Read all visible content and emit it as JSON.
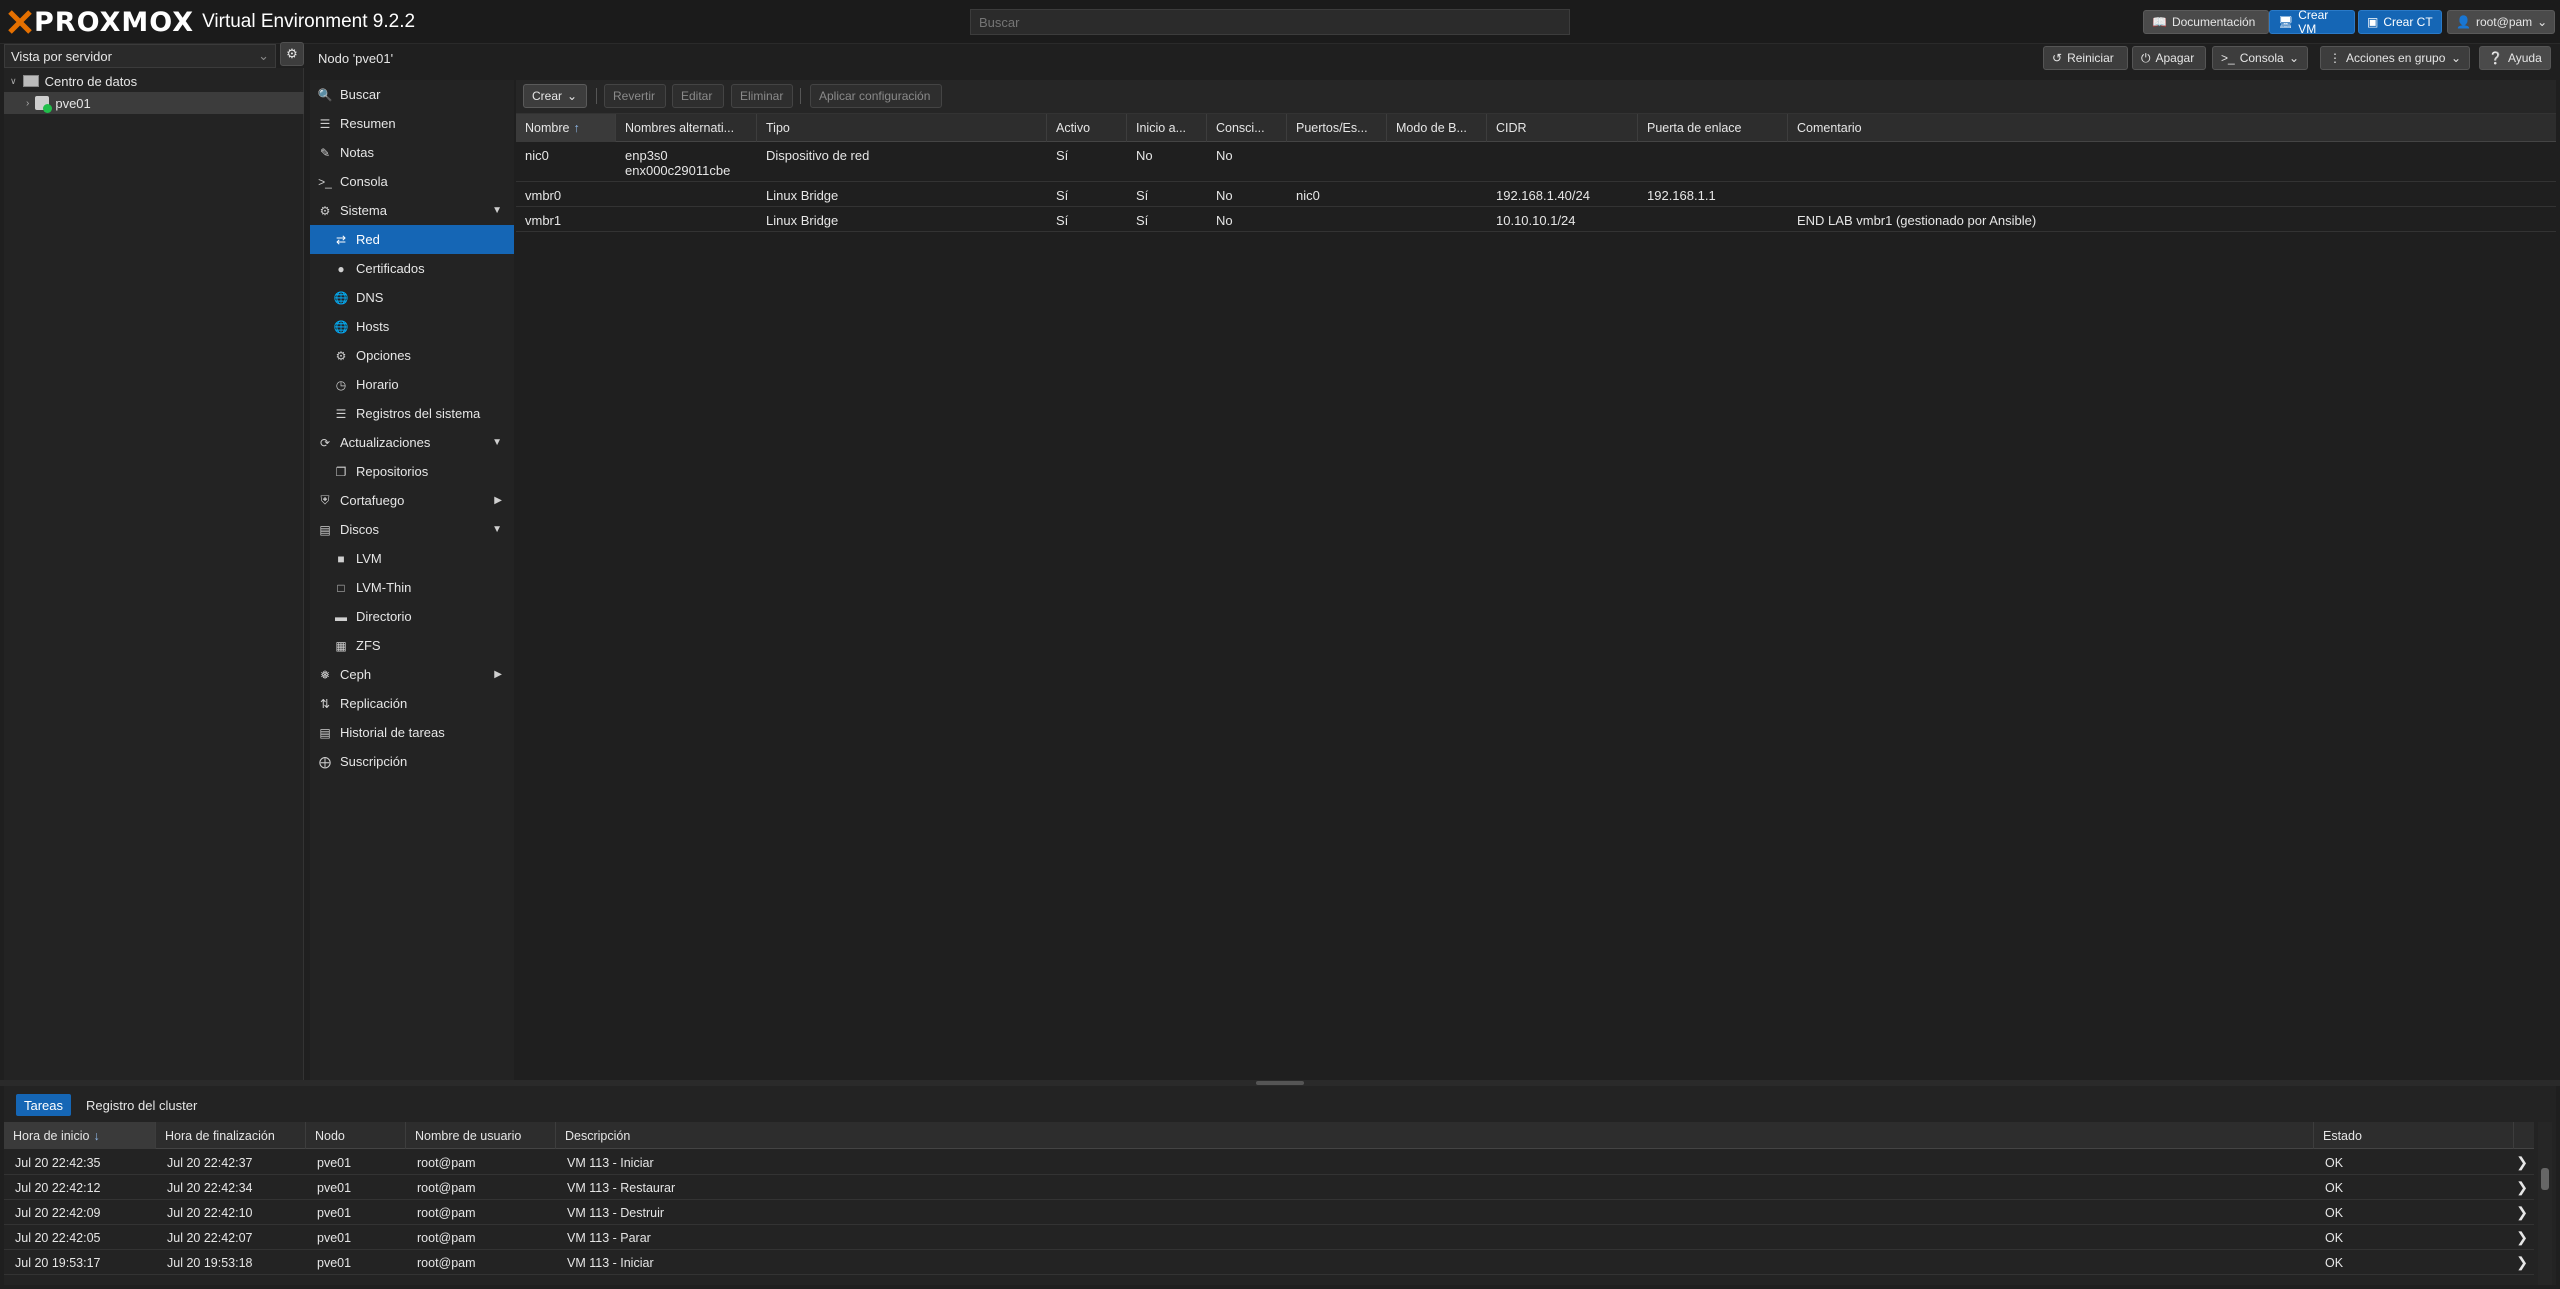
{
  "app": {
    "logo_text": "PROXMOX",
    "product": "Virtual Environment 9.2.2",
    "search_placeholder": "Buscar"
  },
  "topbar": {
    "docs": "Documentación",
    "create_vm": "Crear VM",
    "create_ct": "Crear CT",
    "user": "root@pam"
  },
  "resource_tree": {
    "view": "Vista por servidor",
    "datacenter": "Centro de datos",
    "node": "pve01"
  },
  "node_header": {
    "title": "Nodo 'pve01'",
    "reboot": "Reiniciar",
    "shutdown": "Apagar",
    "console": "Consola",
    "bulk": "Acciones en grupo",
    "help": "Ayuda"
  },
  "nav": [
    {
      "label": "Buscar",
      "icon": "search-icon"
    },
    {
      "label": "Resumen",
      "icon": "book-icon"
    },
    {
      "label": "Notas",
      "icon": "notes-icon"
    },
    {
      "label": "Consola",
      "icon": "terminal-icon"
    },
    {
      "label": "Sistema",
      "icon": "cogs-icon"
    },
    {
      "label": "Red",
      "icon": "exchange-icon"
    },
    {
      "label": "Certificados",
      "icon": "certificate-icon"
    },
    {
      "label": "DNS",
      "icon": "globe-icon"
    },
    {
      "label": "Hosts",
      "icon": "globe-icon"
    },
    {
      "label": "Opciones",
      "icon": "gear-icon"
    },
    {
      "label": "Horario",
      "icon": "clock-icon"
    },
    {
      "label": "Registros del sistema",
      "icon": "list-icon"
    },
    {
      "label": "Actualizaciones",
      "icon": "refresh-icon"
    },
    {
      "label": "Repositorios",
      "icon": "files-icon"
    },
    {
      "label": "Cortafuego",
      "icon": "shield-icon"
    },
    {
      "label": "Discos",
      "icon": "hdd-icon"
    },
    {
      "label": "LVM",
      "icon": "square-icon"
    },
    {
      "label": "LVM-Thin",
      "icon": "square-outline-icon"
    },
    {
      "label": "Directorio",
      "icon": "folder-icon"
    },
    {
      "label": "ZFS",
      "icon": "th-large-icon"
    },
    {
      "label": "Ceph",
      "icon": "ceph-icon"
    },
    {
      "label": "Replicación",
      "icon": "retweet-icon"
    },
    {
      "label": "Historial de tareas",
      "icon": "list-alt-icon"
    },
    {
      "label": "Suscripción",
      "icon": "support-icon"
    }
  ],
  "network_toolbar": {
    "create": "Crear",
    "revert": "Revertir",
    "edit": "Editar",
    "remove": "Eliminar",
    "apply": "Aplicar configuración"
  },
  "network_columns": [
    "Nombre",
    "Nombres alternati...",
    "Tipo",
    "Activo",
    "Inicio a...",
    "Consci...",
    "Puertos/Es...",
    "Modo de B...",
    "CIDR",
    "Puerta de enlace",
    "Comentario"
  ],
  "network_rows": [
    {
      "name": "nic0",
      "alt": "enp3s0\nenx000c29011cbe",
      "type": "Dispositivo de red",
      "active": "Sí",
      "autostart": "No",
      "vlan_aware": "No",
      "ports": "",
      "bond_mode": "",
      "cidr": "",
      "gateway": "",
      "comment": ""
    },
    {
      "name": "vmbr0",
      "alt": "",
      "type": "Linux Bridge",
      "active": "Sí",
      "autostart": "Sí",
      "vlan_aware": "No",
      "ports": "nic0",
      "bond_mode": "",
      "cidr": "192.168.1.40/24",
      "gateway": "192.168.1.1",
      "comment": ""
    },
    {
      "name": "vmbr1",
      "alt": "",
      "type": "Linux Bridge",
      "active": "Sí",
      "autostart": "Sí",
      "vlan_aware": "No",
      "ports": "",
      "bond_mode": "",
      "cidr": "10.10.10.1/24",
      "gateway": "",
      "comment": "END LAB vmbr1 (gestionado por Ansible)"
    }
  ],
  "bottom_tabs": [
    "Tareas",
    "Registro del cluster"
  ],
  "task_columns": [
    "Hora de inicio",
    "Hora de finalización",
    "Nodo",
    "Nombre de usuario",
    "Descripción",
    "Estado"
  ],
  "tasks": [
    {
      "start": "Jul 20 22:42:35",
      "end": "Jul 20 22:42:37",
      "node": "pve01",
      "user": "root@pam",
      "desc": "VM 113 - Iniciar",
      "status": "OK"
    },
    {
      "start": "Jul 20 22:42:12",
      "end": "Jul 20 22:42:34",
      "node": "pve01",
      "user": "root@pam",
      "desc": "VM 113 - Restaurar",
      "status": "OK"
    },
    {
      "start": "Jul 20 22:42:09",
      "end": "Jul 20 22:42:10",
      "node": "pve01",
      "user": "root@pam",
      "desc": "VM 113 - Destruir",
      "status": "OK"
    },
    {
      "start": "Jul 20 22:42:05",
      "end": "Jul 20 22:42:07",
      "node": "pve01",
      "user": "root@pam",
      "desc": "VM 113 - Parar",
      "status": "OK"
    },
    {
      "start": "Jul 20 19:53:17",
      "end": "Jul 20 19:53:18",
      "node": "pve01",
      "user": "root@pam",
      "desc": "VM 113 - Iniciar",
      "status": "OK"
    }
  ],
  "colors": {
    "accent": "#1566b5",
    "brand_orange": "#e57000"
  }
}
